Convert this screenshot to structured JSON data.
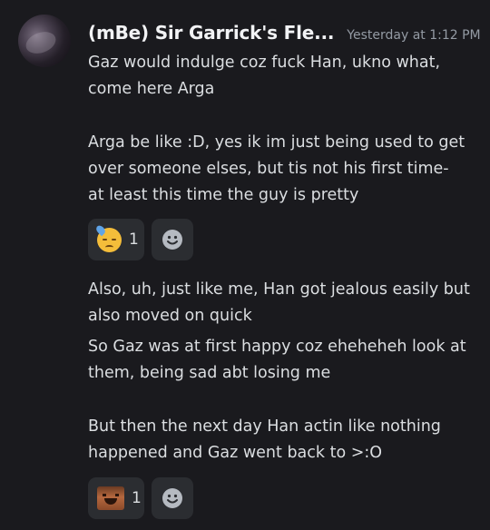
{
  "message": {
    "username": "(mBe) Sir Garrick's Fle...",
    "timestamp": "Yesterday at 1:12 PM",
    "lines": [
      "Gaz would indulge coz fuck Han, ukno what,",
      "come here Arga",
      "Arga be like :D, yes ik im just being used to get",
      "over someone elses, but tis not his first time-",
      "at least this time the guy is pretty",
      "Also, uh, just like me, Han got jealous easily but",
      "also moved on quick",
      "So Gaz was at first happy coz eheheheh look at",
      "them, being sad abt losing me",
      "But then the next day Han actin like nothing",
      "happened and Gaz went back to >:O"
    ]
  },
  "reactions": [
    {
      "icon": "sweat-smile-emoji-icon",
      "count": "1"
    },
    {
      "icon": "crying-face-custom-emoji-icon",
      "count": "1"
    }
  ],
  "add_reaction_icon": "smiley-add-reaction-icon"
}
